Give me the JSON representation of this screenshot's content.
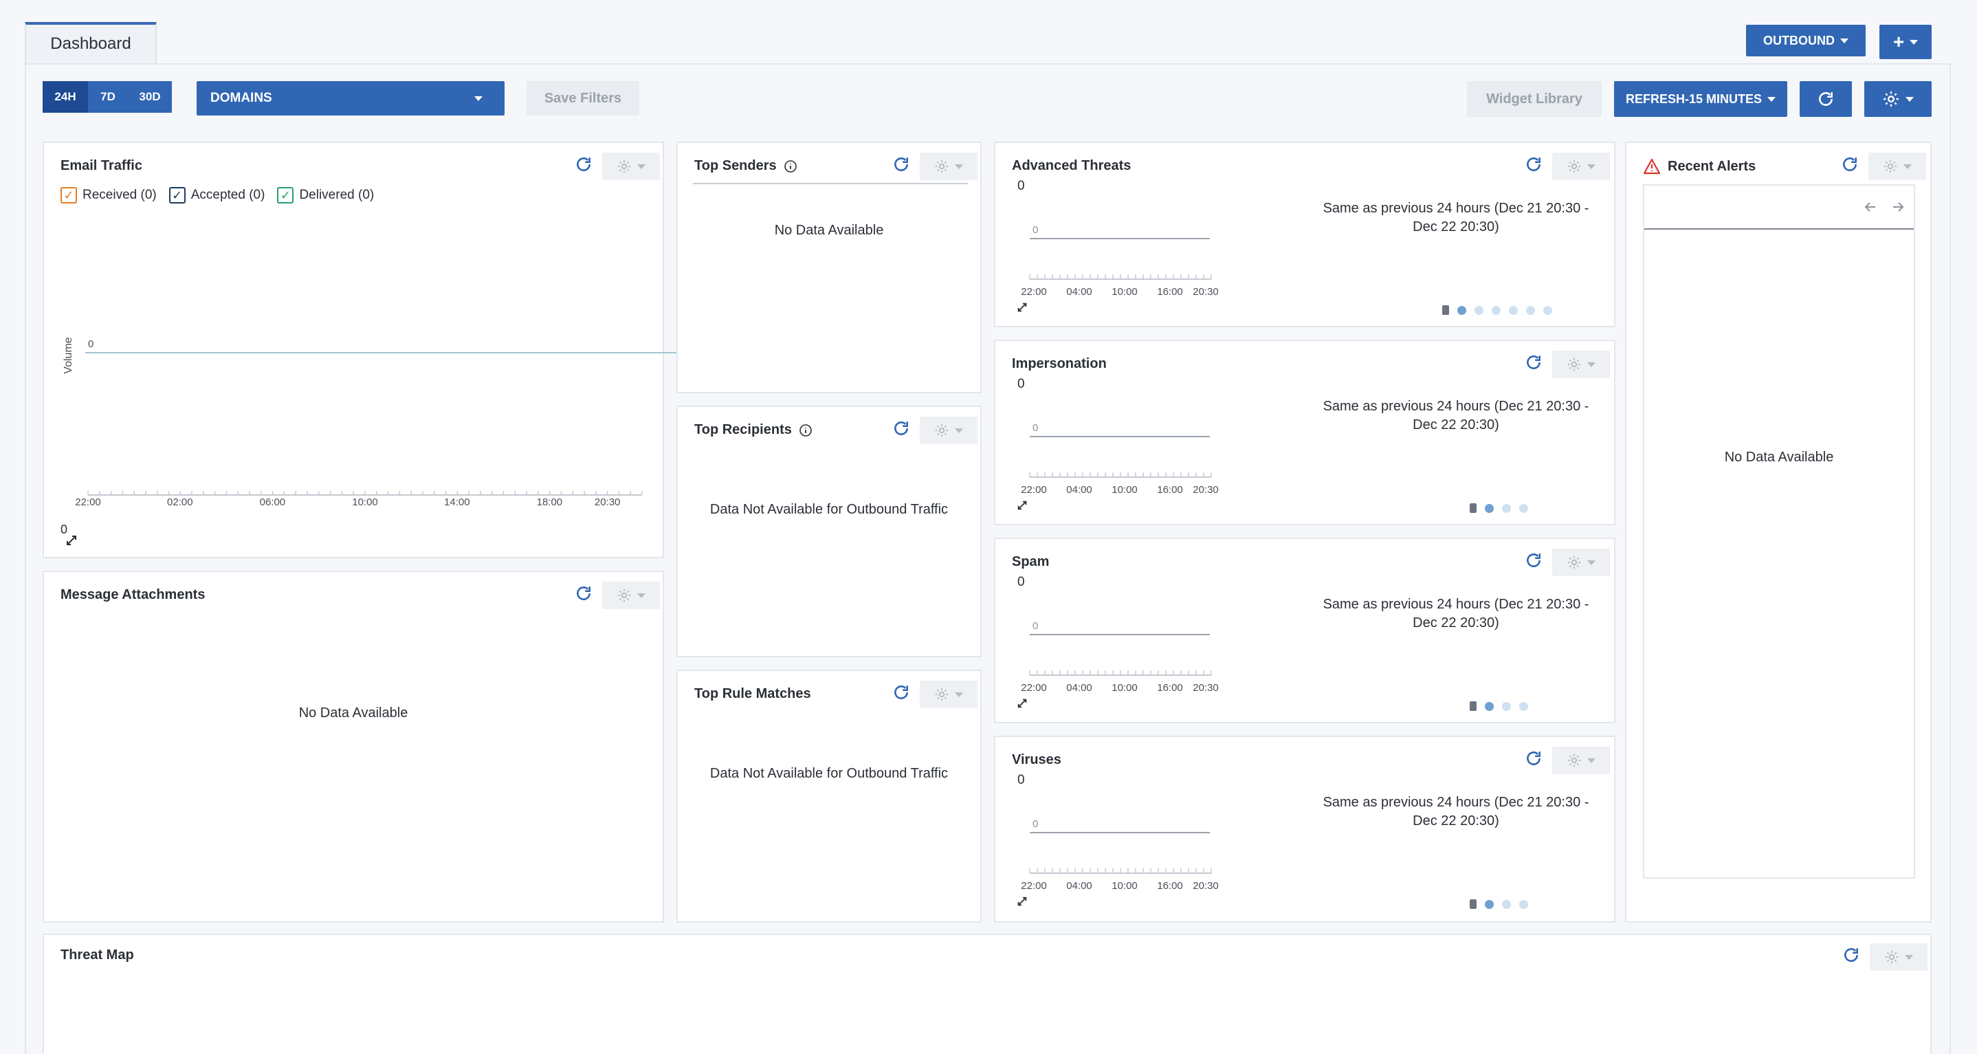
{
  "tabs": {
    "dashboard": "Dashboard"
  },
  "topbar": {
    "direction_label": "OUTBOUND",
    "add_label": "+"
  },
  "toolbar": {
    "ranges": [
      "24H",
      "7D",
      "30D"
    ],
    "active_range": "24H",
    "domains_label": "DOMAINS",
    "save_filters": "Save Filters",
    "widget_library": "Widget Library",
    "refresh_interval": "REFRESH-15 MINUTES"
  },
  "email_traffic": {
    "title": "Email Traffic",
    "legend": [
      {
        "label": "Received (0)",
        "color": "#e67e22"
      },
      {
        "label": "Accepted (0)",
        "color": "#1f3a60"
      },
      {
        "label": "Delivered (0)",
        "color": "#27a06a"
      }
    ],
    "ylabel": "Volume",
    "zero_label": "0",
    "x_ticks": [
      "22:00",
      "02:00",
      "06:00",
      "10:00",
      "14:00",
      "18:00",
      "20:30"
    ],
    "footer_value": "0"
  },
  "top_senders": {
    "title": "Top Senders",
    "message": "No Data Available"
  },
  "top_recipients": {
    "title": "Top Recipients",
    "message": "Data Not Available for Outbound Traffic"
  },
  "top_rule_matches": {
    "title": "Top Rule Matches",
    "message": "Data Not Available for Outbound Traffic"
  },
  "message_attachments": {
    "title": "Message Attachments",
    "message": "No Data Available"
  },
  "threats": [
    {
      "title": "Advanced Threats",
      "value": "0",
      "zero": "0",
      "comparison": "Same as previous 24 hours (Dec 21 20:30 - Dec 22 20:30)",
      "x_ticks": [
        "22:00",
        "04:00",
        "10:00",
        "16:00",
        "20:30"
      ],
      "pages": 6
    },
    {
      "title": "Impersonation",
      "value": "0",
      "zero": "0",
      "comparison": "Same as previous 24 hours (Dec 21 20:30 - Dec 22 20:30)",
      "x_ticks": [
        "22:00",
        "04:00",
        "10:00",
        "16:00",
        "20:30"
      ],
      "pages": 3
    },
    {
      "title": "Spam",
      "value": "0",
      "zero": "0",
      "comparison": "Same as previous 24 hours (Dec 21 20:30 - Dec 22 20:30)",
      "x_ticks": [
        "22:00",
        "04:00",
        "10:00",
        "16:00",
        "20:30"
      ],
      "pages": 3
    },
    {
      "title": "Viruses",
      "value": "0",
      "zero": "0",
      "comparison": "Same as previous 24 hours (Dec 21 20:30 - Dec 22 20:30)",
      "x_ticks": [
        "22:00",
        "04:00",
        "10:00",
        "16:00",
        "20:30"
      ],
      "pages": 3
    }
  ],
  "recent_alerts": {
    "title": "Recent Alerts",
    "message": "No Data Available"
  },
  "threat_map": {
    "title": "Threat Map"
  },
  "colors": {
    "accent": "#3166b4",
    "alert": "#d9342b"
  }
}
